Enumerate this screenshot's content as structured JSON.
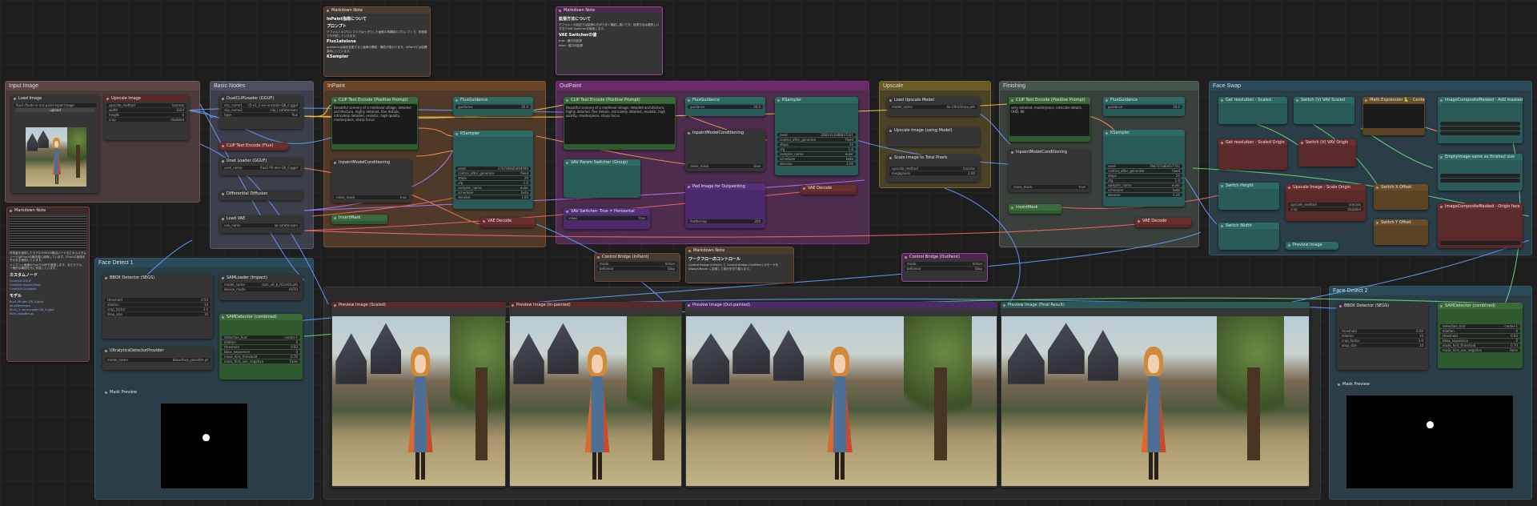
{
  "groups": {
    "input": "Input Image",
    "basic": "Basic Nodes",
    "inpaint": "InPaint",
    "outpaint": "OutPaint",
    "upscale": "Upscale",
    "finishing": "Finishing",
    "face_swap": "Face Swap",
    "face_detect1": "Face Detect 1",
    "face_detect2": "Face Detect 2"
  },
  "nodes": {
    "md_top1": {
      "title": "Markdown Note",
      "h1": "InPaint指南について",
      "h2": "プロンプト",
      "p1": "デフォルトのプロンプトではっきりした画像の再構成のプロンプトで、非推奨ですが試していきます。",
      "h3": "Flux1atelona",
      "p2": "guidanceは値を変更すると画像の構成・構成が変わります。InPaintでは結構高めにしています。",
      "h4": "KSampler"
    },
    "md_top2": {
      "title": "Markdown Note",
      "h1": "拡張方法について",
      "p1": "デフォルトの設定では拡張の方がうまく機能し易いです。拡張方法は選択しい方法でVAE Switcherを使用します。",
      "h2": "VAE Switcherの値",
      "li1": "true : 横方向拡張",
      "li2": "false : 縦方向拡張"
    },
    "load_image": {
      "title": "Load Image",
      "file": "flux1-fluids-in-out-paint-input-image",
      "upload": "upload"
    },
    "upscale_image": {
      "title": "Upscale Image",
      "w1": "upscale_method",
      "v1": "lanczos",
      "w2": "width",
      "v2": "1024",
      "w3": "height",
      "v3": "0",
      "w4": "crop",
      "v4": "disabled"
    },
    "dual_clip": {
      "title": "DualCLIPLoader (GGUF)",
      "w1": "clip_name1",
      "v1": "t5-v1_1-xxl-encoder-Q8_0.gguf",
      "w2": "clip_name2",
      "v2": "clip_l.safetensors",
      "w3": "type",
      "v3": "flux"
    },
    "clip_te_flux": {
      "title": "CLIP Text Encode (Flux)"
    },
    "unet_loader": {
      "title": "Unet Loader (GGUF)",
      "w1": "unet_name",
      "v1": "flux1-fill-dev-Q8_0.gguf"
    },
    "diff_diff": {
      "title": "Differential Diffusion"
    },
    "load_vae": {
      "title": "Load VAE",
      "w1": "vae_name",
      "v1": "ae.safetensors"
    },
    "md_left": {
      "title": "Markdown Note",
      "p1": "作成者を使用したモデルやSEGS検出ノードなどのカスタムノードはFlux1の最先端に使用しています。Flux1の推奨をそのまま使用しています。",
      "p2": "インプット画像のFluxで1MPを推奨します。またモデル、一般的な構成を元に作成しています。",
      "h1": "カスタムノード",
      "l1": "ComfyUI-GGUF",
      "l2": "ComfyUI-Impact-Pack",
      "l3": "ComfyUI-Crystools",
      "h2": "モデル",
      "l4": "flux1-fill-dev-Q8_0.gguf",
      "l5": "ae.safetensors",
      "l6": "t5-v1_1-xxl-encoder-Q8_0.gguf",
      "l7": "face_yolov8m.pt"
    },
    "bbox1": {
      "title": "BBOX Detector (SEGS)",
      "w1": "threshold",
      "v1": "0.50",
      "w2": "dilation",
      "v2": "10",
      "w3": "crop_factor",
      "v3": "3.0",
      "w4": "drop_size",
      "v4": "10"
    },
    "sam_loader": {
      "title": "SAMLoader (Impact)",
      "w1": "model_name",
      "v1": "sam_vit_b_01ec64.pth",
      "w2": "device_mode",
      "v2": "AUTO"
    },
    "ultra_provider": {
      "title": "UltralyticsDetectorProvider",
      "w1": "model_name",
      "v1": "bbox/face_yolov8m.pt"
    },
    "sam_detector1": {
      "title": "SAMDetector (combined)",
      "w1": "detection_hint",
      "v1": "center-1",
      "w2": "dilation",
      "v2": "0",
      "w3": "threshold",
      "v3": "0.93",
      "w4": "bbox_expansion",
      "v4": "0",
      "w5": "mask_hint_threshold",
      "v5": "0.70",
      "w6": "mask_hint_use_negative",
      "v6": "False"
    },
    "mask_preview1": {
      "title": "Mask Preview"
    },
    "ip_clip": {
      "title": "CLIP Text Encode (Positive Prompt)",
      "text": "Beautiful scenery of a medieval village, detailed architecture, highly detailed, fine details, intricately detailed, realistic, high quality, masterpiece, sharp focus"
    },
    "ip_flux_guid": {
      "title": "FluxGuidance",
      "w1": "guidance",
      "v1": "30.0"
    },
    "ip_ksampler": {
      "title": "KSampler",
      "w1": "seed",
      "v1": "270746005694590",
      "w2": "control_after_generate",
      "v2": "fixed",
      "w3": "steps",
      "v3": "20",
      "w4": "cfg",
      "v4": "1.0",
      "w5": "sampler_name",
      "v5": "euler",
      "w6": "scheduler",
      "v6": "beta",
      "w7": "denoise",
      "v7": "1.00"
    },
    "ip_inpaint_cond": {
      "title": "InpaintModelConditioning",
      "w1": "noise_mask",
      "v1": "true"
    },
    "ip_inverse": {
      "title": "InvertMask"
    },
    "ip_vae_decode": {
      "title": "VAE Decode"
    },
    "op_clip": {
      "title": "CLIP Text Encode (Positive Prompt)",
      "text": "Beautiful scenery of a medieval village, detailed architecture, highly detailed, fine details, intricately detailed, realistic, high quality, masterpiece, sharp focus"
    },
    "op_flux_guid": {
      "title": "FluxGuidance",
      "w1": "guidance",
      "v1": "30.0"
    },
    "op_inpaint_cond": {
      "title": "InpaintModelConditioning",
      "w1": "noise_mask",
      "v1": "true"
    },
    "op_ksampler": {
      "title": "KSampler",
      "w1": "seed",
      "v1": "2081414388837161",
      "w2": "control_after_generate",
      "v2": "fixed",
      "w3": "steps",
      "v3": "20",
      "w4": "cfg",
      "v4": "1.0",
      "w5": "sampler_name",
      "v5": "euler",
      "w6": "scheduler",
      "v6": "beta",
      "w7": "denoise",
      "v7": "1.00"
    },
    "op_param_switch": {
      "title": "VAV Param Switcher (Group)"
    },
    "op_pad": {
      "title": "Pad Image for Outpainting",
      "w1": "feathering",
      "v1": "200"
    },
    "op_vae_decode": {
      "title": "VAE Decode"
    },
    "op_vav_switch": {
      "title": "VAV Switcher: True = Horizontal",
      "w1": "value",
      "v1": "true"
    },
    "cb_inpaint": {
      "title": "Control Bridge (InPaint)",
      "w1": "mode",
      "v1": "Active",
      "w2": "behavior",
      "v2": "Stop"
    },
    "md_center": {
      "title": "Markdown Note",
      "h1": "ワークフローのコントロール",
      "p1": "Control Bridge (InPaint) と Control Bridge (OutPaint) のモードを Always/Never に変更して実行を切り替えます。"
    },
    "cb_outpaint": {
      "title": "Control Bridge (OutPaint)",
      "w1": "mode",
      "v1": "Active",
      "w2": "behavior",
      "v2": "Stop"
    },
    "up_loader": {
      "title": "Load Upscale Model",
      "w1": "model_name",
      "v1": "4x-UltraSharp.pth"
    },
    "up_with_model": {
      "title": "Upscale Image (using Model)"
    },
    "up_scale_total": {
      "title": "Scale Image to Total Pixels",
      "w1": "upscale_method",
      "v1": "lanczos",
      "w2": "megapixels",
      "v2": "2.00"
    },
    "fin_clip": {
      "title": "CLIP Text Encode (Positive Prompt)",
      "text": "very detailed, masterpiece, intricate details, UHD, 8K"
    },
    "fin_flux_guid": {
      "title": "FluxGuidance",
      "w1": "guidance",
      "v1": "30.0"
    },
    "fin_inpaint_cond": {
      "title": "InpaintModelConditioning",
      "w1": "noise_mask",
      "v1": "true"
    },
    "fin_ksampler": {
      "title": "KSampler",
      "w1": "seed",
      "v1": "794725383457741",
      "w2": "control_after_generate",
      "v2": "fixed",
      "w3": "steps",
      "v3": "20",
      "w4": "cfg",
      "v4": "1.0",
      "w5": "sampler_name",
      "v5": "euler",
      "w6": "scheduler",
      "v6": "beta",
      "w7": "denoise",
      "v7": "0.20"
    },
    "fin_invert": {
      "title": "InvertMask"
    },
    "fin_vae_decode": {
      "title": "VAE Decode"
    },
    "fs_get_res": {
      "title": "Get resolution - Scaled"
    },
    "fs_switch_vav": {
      "title": "Switch (V) VAV Scaled"
    },
    "fs_math": {
      "title": "Math Expression 🐍 - Centering"
    },
    "fs_composite": {
      "title": "ImageCompositeMasked - Add masked Face"
    },
    "fs_get_res2": {
      "title": "Get resolution - Scaled Origin"
    },
    "fs_switch_vav2": {
      "title": "Switch (V) VAV Origin"
    },
    "fs_empty": {
      "title": "EmptyImage-same as finished size"
    },
    "fs_switch_h": {
      "title": "Switch Height"
    },
    "fs_upscale": {
      "title": "Upscale Image - Scale Origin",
      "w1": "upscale_method",
      "v1": "lanczos",
      "w2": "crop",
      "v2": "disabled"
    },
    "fs_switch_x": {
      "title": "Switch X Offset"
    },
    "fs_composite2": {
      "title": "ImageCompositeMasked - Origin face"
    },
    "fs_switch_w": {
      "title": "Switch Width"
    },
    "fs_switch_y": {
      "title": "Switch Y Offset"
    },
    "fs_preview": {
      "title": "Preview Image"
    },
    "prev_scaled": {
      "title": "Preview Image (Scaled)"
    },
    "prev_inpaint": {
      "title": "Preview Image (In-painted)"
    },
    "prev_outpaint": {
      "title": "Preview Image (Out-painted)"
    },
    "prev_final": {
      "title": "Preview Image (Final Result)"
    },
    "bbox2": {
      "title": "BBOX Detector (SEGS)",
      "w1": "threshold",
      "v1": "0.50",
      "w2": "dilation",
      "v2": "10",
      "w3": "crop_factor",
      "v3": "3.0",
      "w4": "drop_size",
      "v4": "10"
    },
    "sam_detector2": {
      "title": "SAMDetector (combined)",
      "w1": "detection_hint",
      "v1": "center-1",
      "w2": "dilation",
      "v2": "0",
      "w3": "threshold",
      "v3": "0.93",
      "w4": "bbox_expansion",
      "v4": "0",
      "w5": "mask_hint_threshold",
      "v5": "0.70",
      "w6": "mask_hint_use_negative",
      "v6": "False"
    },
    "mask_preview2": {
      "title": "Mask Preview"
    }
  },
  "colors": {
    "canvas": "#1e1e1e",
    "input_group": "#4a3b3b",
    "basic_group": "#3d3f4a",
    "inpaint_group": "#6a4424",
    "outpaint_group": "#6a2a6a",
    "upscale_group": "#6a5a24",
    "finishing_group": "#3f4a44",
    "faceswap_group": "#2a4a5a",
    "facedetect_group": "#2a4a5a",
    "node_green": "#2f5a2f",
    "node_teal": "#2a5a55",
    "node_red": "#5a2a2a",
    "node_purple": "#4a2a6a",
    "node_brown": "#5a4224"
  }
}
